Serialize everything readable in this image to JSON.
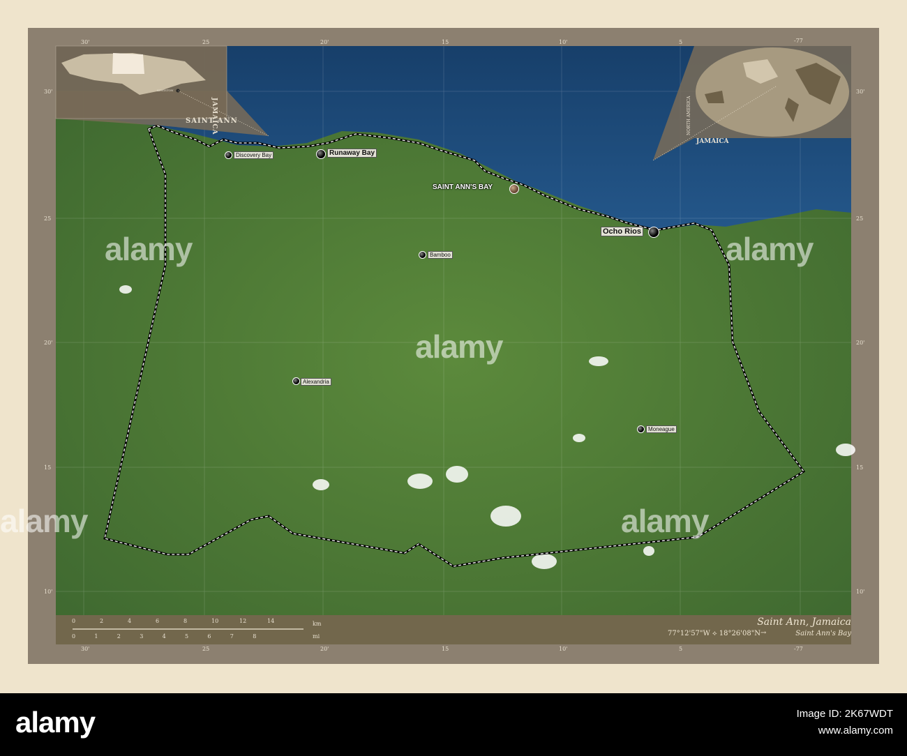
{
  "map": {
    "title": "Saint Ann, Jamaica",
    "coordinates": "77°12'57\"W ⟡ 18°26'08\"N",
    "arrow": "→",
    "capital": "Saint Ann's Bay",
    "scale": {
      "km_unit": "km",
      "mi_unit": "mi",
      "km_ticks": [
        "0",
        "2",
        "4",
        "6",
        "8",
        "10",
        "12",
        "14"
      ],
      "mi_ticks": [
        "0",
        "1",
        "2",
        "3",
        "4",
        "5",
        "6",
        "7",
        "8"
      ]
    },
    "top_ticks": [
      "30'",
      "25",
      "20'",
      "15",
      "10'",
      "5",
      "-77"
    ],
    "side_ticks": [
      "30'",
      "25",
      "20'",
      "15",
      "10'"
    ],
    "inset_jamaica": {
      "label_country": "Jamaica",
      "label_region": "Saint Ann",
      "label_capital": "Kingston"
    },
    "inset_world": {
      "label_continent": "North America",
      "label_country": "Jamaica"
    },
    "cities": [
      {
        "name": "Discovery Bay",
        "size": "small"
      },
      {
        "name": "Runaway Bay",
        "size": "big"
      },
      {
        "name": "Saint Ann's Bay",
        "size": "capital"
      },
      {
        "name": "Ocho Rios",
        "size": "big"
      },
      {
        "name": "Bamboo",
        "size": "small"
      },
      {
        "name": "Alexandria",
        "size": "small"
      },
      {
        "name": "Moneague",
        "size": "small"
      }
    ]
  },
  "watermark": "alamy",
  "footer": {
    "logo": "alamy",
    "image_id": "Image ID: 2K67WDT",
    "url": "www.alamy.com"
  },
  "colors": {
    "frame": "#8c8070",
    "sea": "#1d4a78",
    "land": "#4f7a38",
    "background": "#efe4cc"
  }
}
